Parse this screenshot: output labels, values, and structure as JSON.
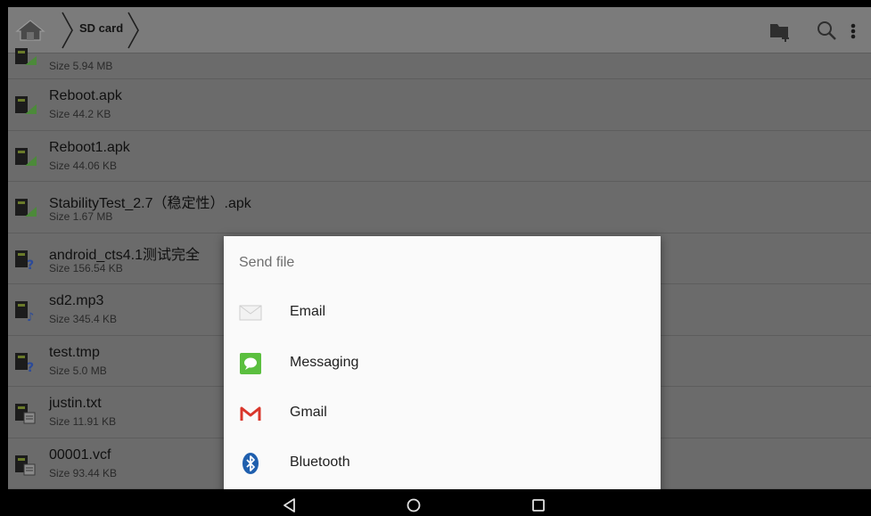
{
  "toolbar": {
    "breadcrumb_current": "SD card",
    "icons": [
      "home-icon",
      "new-folder-icon",
      "search-icon",
      "overflow-menu-icon"
    ]
  },
  "files": [
    {
      "name": "",
      "size": "Size 5.94 MB",
      "type": "apk"
    },
    {
      "name": "Reboot.apk",
      "size": "Size 44.2 KB",
      "type": "apk"
    },
    {
      "name": "Reboot1.apk",
      "size": "Size 44.06 KB",
      "type": "apk"
    },
    {
      "name": "StabilityTest_2.7（稳定性）.apk",
      "size": "Size 1.67 MB",
      "type": "apk"
    },
    {
      "name": "android_cts4.1测试完全",
      "size": "Size 156.54 KB",
      "type": "unknown"
    },
    {
      "name": "sd2.mp3",
      "size": "Size 345.4 KB",
      "type": "audio"
    },
    {
      "name": "test.tmp",
      "size": "Size 5.0 MB",
      "type": "unknown"
    },
    {
      "name": "justin.txt",
      "size": "Size 11.91 KB",
      "type": "text"
    },
    {
      "name": "00001.vcf",
      "size": "Size 93.44 KB",
      "type": "text"
    }
  ],
  "dialog": {
    "title": "Send file",
    "options": [
      {
        "label": "Email",
        "icon": "email-icon"
      },
      {
        "label": "Messaging",
        "icon": "messaging-icon"
      },
      {
        "label": "Gmail",
        "icon": "gmail-icon"
      },
      {
        "label": "Bluetooth",
        "icon": "bluetooth-icon"
      }
    ]
  },
  "navbar": {
    "icons": [
      "back-icon",
      "home-nav-icon",
      "recents-icon"
    ]
  }
}
